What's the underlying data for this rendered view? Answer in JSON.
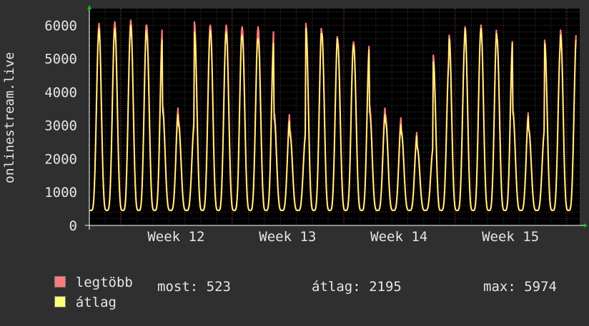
{
  "chart_data": {
    "type": "line",
    "ylabel": "onlinestream.live",
    "ylim": [
      0,
      6500
    ],
    "y_ticks": [
      "0",
      "1000",
      "2000",
      "3000",
      "4000",
      "5000",
      "6000"
    ],
    "x_ticks": [
      "Week 12",
      "Week 13",
      "Week 14",
      "Week 15"
    ],
    "grid": true,
    "series": [
      {
        "name": "legtöbb",
        "color": "#ff7a7a",
        "daily_peaks": [
          5950,
          6050,
          6100,
          6150,
          6000,
          3600,
          3150,
          6100,
          6000,
          6000,
          5950,
          5950,
          3400,
          2850,
          6050,
          5800,
          5550,
          5500,
          3600,
          3300,
          2850,
          2350,
          5100,
          5700,
          5950,
          6000,
          5650,
          3450,
          2900,
          5550,
          5850
        ]
      },
      {
        "name": "átlag",
        "color": "#ffff7a",
        "daily_peaks": [
          5750,
          5900,
          5900,
          6000,
          5700,
          3400,
          3000,
          5800,
          5850,
          5800,
          5700,
          5600,
          3200,
          2700,
          5900,
          5750,
          5450,
          5400,
          3400,
          3100,
          2750,
          2300,
          4900,
          5600,
          5900,
          5900,
          5600,
          3350,
          2850,
          5450,
          5700
        ]
      }
    ]
  },
  "legend": {
    "max_label": "legtöbb",
    "avg_label": "átlag",
    "max_color": "#ff7a7a",
    "avg_color": "#ffff7a"
  },
  "stats": {
    "now": "most: 523",
    "avg": "átlag: 2195",
    "max": "max: 5974"
  }
}
